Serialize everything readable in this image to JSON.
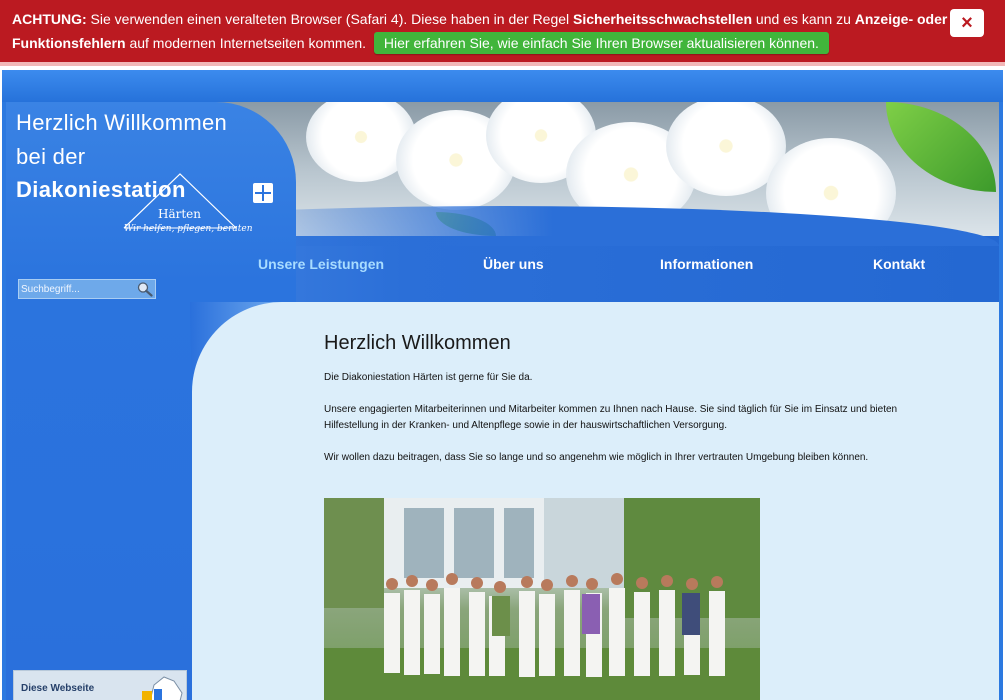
{
  "warning": {
    "prefix": "ACHTUNG:",
    "text1": " Sie verwenden einen veralteten Browser (Safari 4). Diese haben in der Regel ",
    "bold1": "Sicherheitsschwachstellen",
    "text2": " und es kann zu ",
    "bold2": "Anzeige- oder Funktionsfehlern",
    "text3": " auf modernen Internetseiten kommen. ",
    "cta": "Hier erfahren Sie, wie einfach Sie Ihren Browser aktualisieren können.",
    "close": "×"
  },
  "logo": {
    "line1": "Herzlich Willkommen",
    "line2": "bei der",
    "name": "Diakoniestation",
    "town": "Härten",
    "slogan": "Wir helfen, pflegen, beraten"
  },
  "nav": {
    "items": [
      {
        "label": "Unsere Leistungen",
        "active": true
      },
      {
        "label": "Über uns"
      },
      {
        "label": "Informationen"
      },
      {
        "label": "Kontakt"
      }
    ]
  },
  "search": {
    "placeholder": "Suchbegriff..."
  },
  "article": {
    "heading": "Herzlich Willkommen",
    "p1": " Die Diakoniestation Härten ist gerne für Sie da.",
    "p2": "Unsere engagierten Mitarbeiterinnen und Mitarbeiter kommen zu Ihnen nach Hause. Sie sind täglich für Sie im Einsatz und bieten Hilfestellung in der Kranken- und Altenpflege sowie in der hauswirtschaftlichen Versorgung.",
    "p3": "Wir wollen dazu beitragen, dass Sie so lange und so angenehm wie möglich in Ihrer vertrauten Umgebung bleiben können."
  },
  "badge": {
    "text": "Diese Webseite"
  },
  "colors": {
    "warning_bg": "#bb1a21",
    "cta_green": "#41b53b",
    "site_blue": "#2b74de",
    "content_bg": "#dceefa",
    "nav_active": "#a8dcff"
  },
  "icons": [
    "close-icon",
    "search-icon",
    "logo-cross-icon"
  ]
}
